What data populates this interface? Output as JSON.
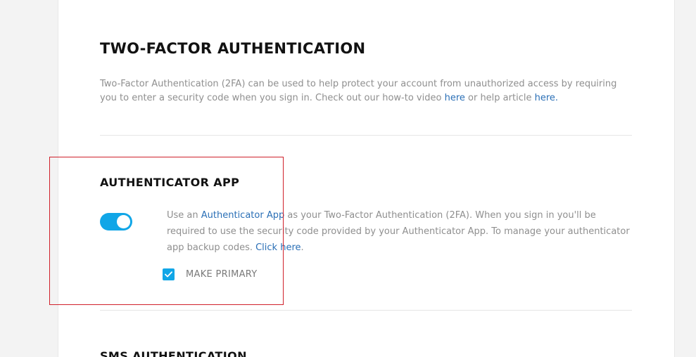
{
  "header": {
    "title": "TWO-FACTOR AUTHENTICATION",
    "intro_text": "Two-Factor Authentication (2FA) can be used to help protect your account from unauthorized access by requiring you to enter a security code when you sign in. Check out our how-to video ",
    "video_link": "here",
    "intro_mid": " or help article ",
    "article_link": "here.",
    "accent_color": "#11a6e7",
    "link_color": "#2a6fb6"
  },
  "authenticator": {
    "title": "AUTHENTICATOR APP",
    "toggle_on": true,
    "desc_start": "Use an ",
    "app_link": "Authenticator App",
    "desc_mid": " as your Two-Factor Authentication (2FA). When you sign in you'll be required to use the security code provided by your Authenticator App. To manage your authenticator app backup codes. ",
    "click_link": "Click here",
    "desc_end": ".",
    "make_primary_label": "MAKE PRIMARY",
    "make_primary_checked": true
  },
  "sms": {
    "title": "SMS AUTHENTICATION"
  },
  "annotation": {
    "highlight_color": "#d0202a"
  }
}
